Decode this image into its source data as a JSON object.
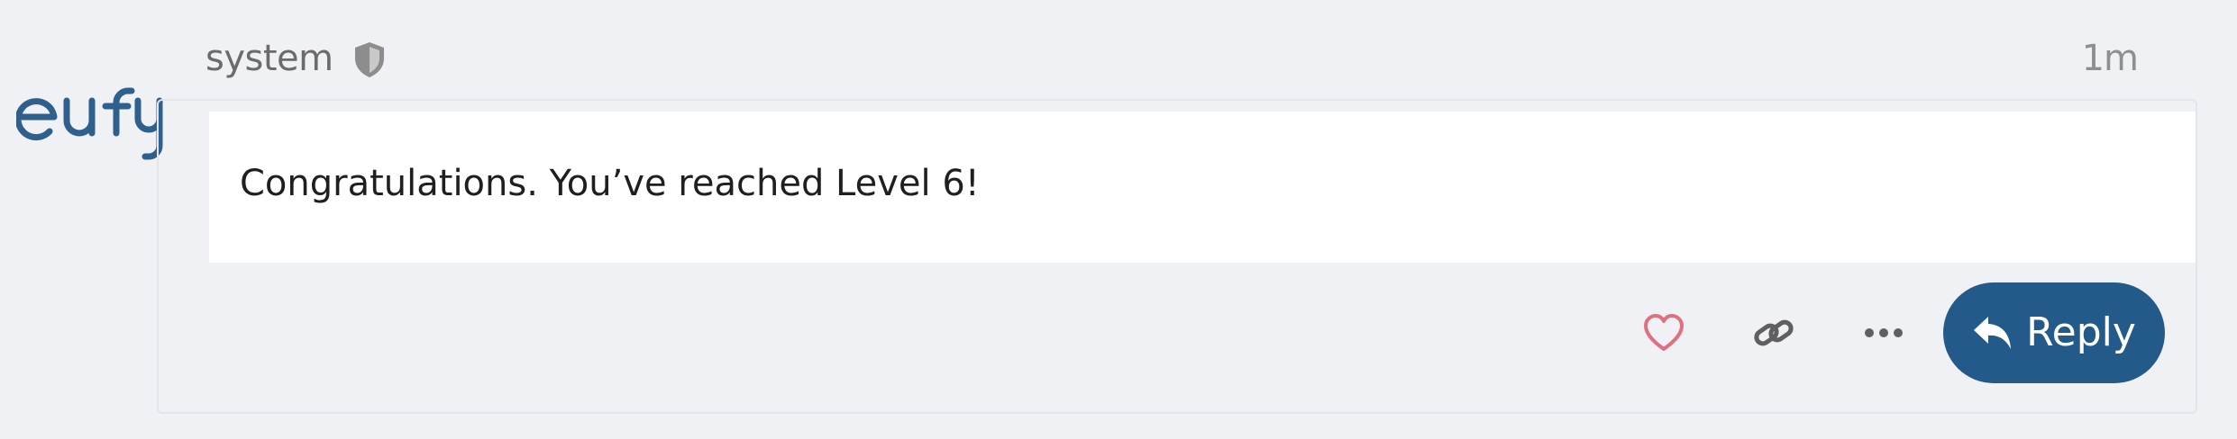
{
  "post": {
    "username": "system",
    "timestamp": "1m",
    "message": "Congratulations. You’ve reached Level 6!"
  },
  "actions": {
    "reply_label": "Reply",
    "like_icon": "heart-icon",
    "share_icon": "link-icon",
    "more_icon": "ellipsis-icon",
    "reply_icon": "reply-arrow-icon"
  },
  "avatar": {
    "logo": "eufy"
  },
  "colors": {
    "background": "#f0f1f5",
    "accent": "#235a89",
    "like": "#e0707f",
    "text": "#1f1f1f",
    "muted": "#6b6b6b"
  }
}
